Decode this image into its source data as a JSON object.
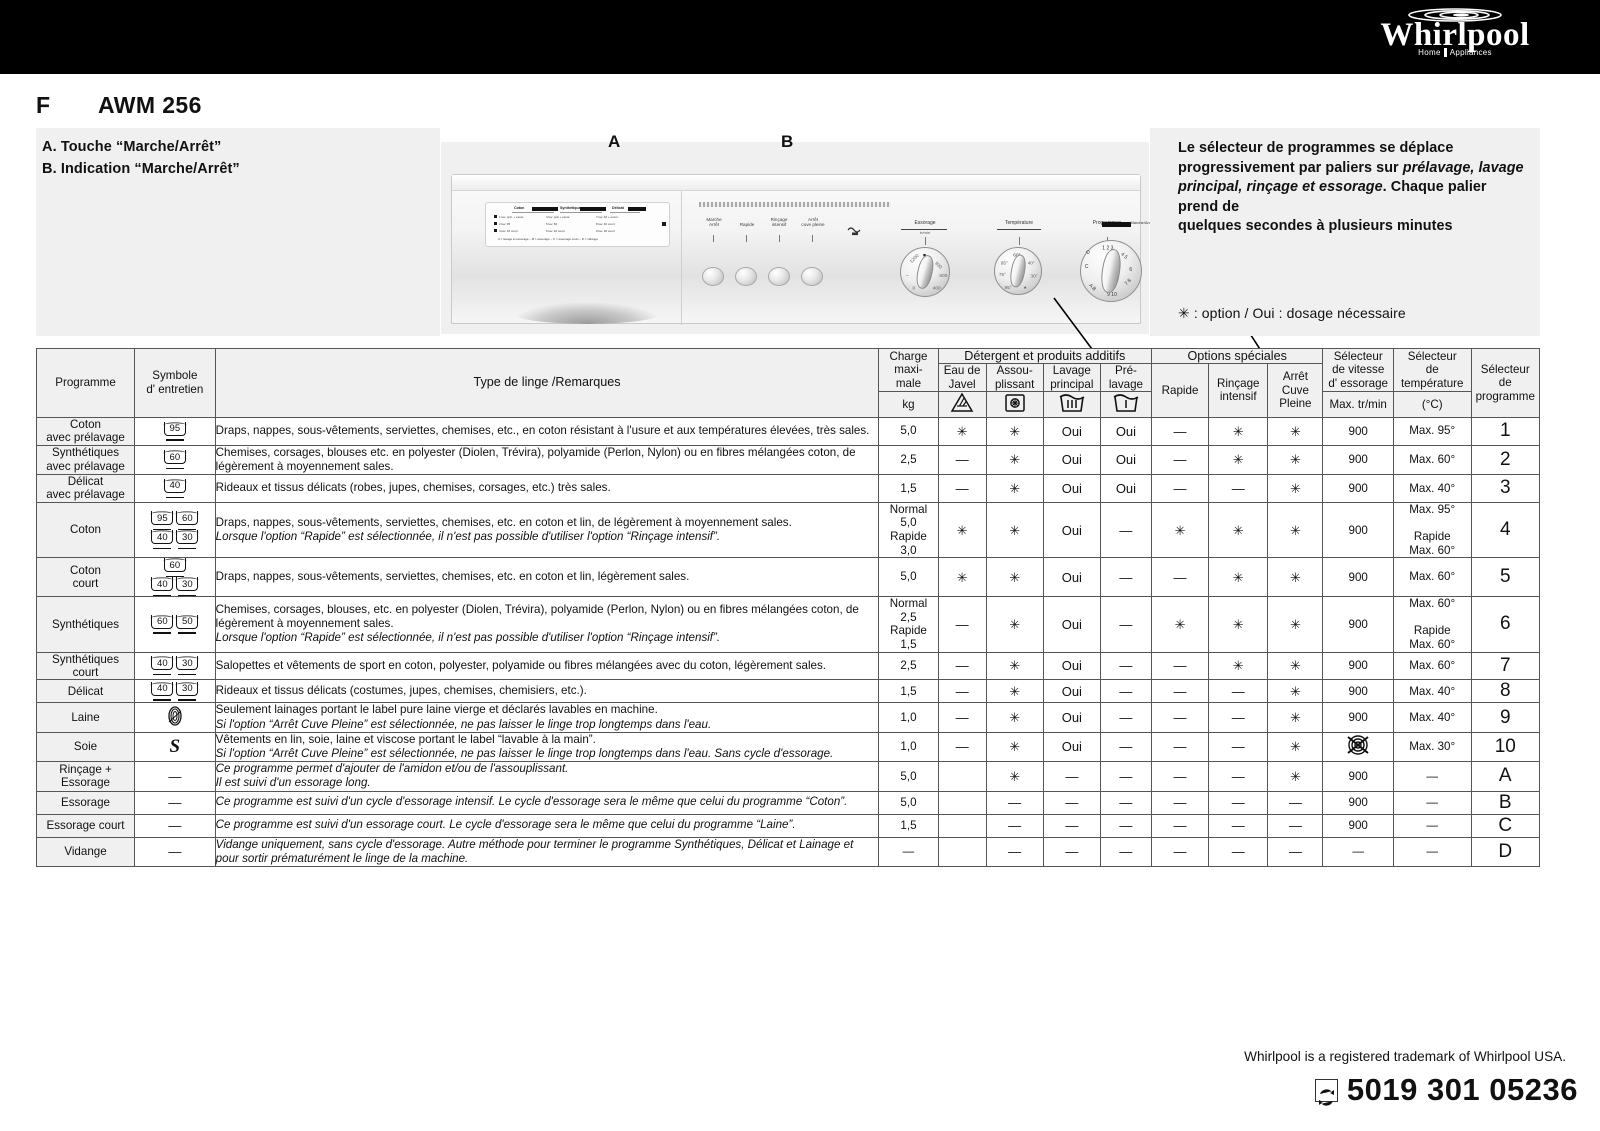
{
  "brand": {
    "name": "Whirlpool",
    "tagline_left": "Home",
    "tagline_right": "Appliances"
  },
  "header": {
    "language_code": "F",
    "model": "AWM 256"
  },
  "legend_box": {
    "items": [
      "A. Touche “Marche/Arrêt”",
      "B. Indication “Marche/Arrêt”"
    ]
  },
  "callouts": {
    "a": "A",
    "b": "B"
  },
  "illustration": {
    "program_card": {
      "columns": [
        "Coton",
        "Synthétiques",
        "Délicat"
      ],
      "footer": "A = lavage et essorage  –  B = essorage  –  C = essorage court  –  D = vidange"
    },
    "buttons": [
      {
        "label_line1": "Marche",
        "label_line2": "Arrêt"
      },
      {
        "label_line1": "Rapide",
        "label_line2": ""
      },
      {
        "label_line1": "Rinçage",
        "label_line2": "intensif"
      },
      {
        "label_line1": "Arrêt",
        "label_line2": "cuve pleine"
      }
    ],
    "knobs": [
      {
        "label": "Essorage",
        "sub": "tr/min"
      },
      {
        "label": "Température",
        "sub": ""
      },
      {
        "label": "Programmes",
        "sub": ""
      }
    ],
    "selector_side_label": "Marche/Arrêt"
  },
  "note": {
    "line1": "Le sélecteur de programmes se déplace",
    "line2_plain": "progressivement par paliers sur ",
    "line2_em": "prélavage, lavage",
    "line3_em": "principal, rinçage et essorage",
    "line3_plain": ". Chaque palier prend de",
    "line4": "quelques secondes à plusieurs minutes",
    "legend": "✳ : option / Oui : dosage nécessaire"
  },
  "table": {
    "headers": {
      "programme": "Programme",
      "symbole": "Symbole\nd' entretien",
      "type_linge": "Type de linge /Remarques",
      "charge": "Charge\nmaxi-\nmale",
      "charge_unit": "kg",
      "group_detergent": "Détergent et produits additifs",
      "group_options": "Options spéciales",
      "eau_javel": "Eau de\nJavel",
      "assouplissant": "Assou-\nplissant",
      "lavage_principal": "Lavage\nprincipal",
      "prelavage": "Pré-\nlavage",
      "rapide": "Rapide",
      "rincage_intensif": "Rinçage\nintensif",
      "arret_cuve": "Arrêt\nCuve\nPleine",
      "sel_vitesse": "Sélecteur\nde vitesse\nd' essorage",
      "sel_vitesse_unit": "Max. tr/min",
      "sel_temp": "Sélecteur\nde\ntempérature",
      "sel_temp_unit": "(°C)",
      "sel_prog": "Sélecteur\nde\nprogramme"
    },
    "rows": [
      {
        "programme": "Coton\navec prélavage",
        "symbols": [
          [
            "95"
          ]
        ],
        "desc": "Draps, nappes, sous-vêtements, serviettes, chemises, etc., en coton résistant à l'usure et aux températures élevées, très sales.",
        "desc_italic": "",
        "charge": "5,0",
        "eau_javel": "✳",
        "assouplissant": "✳",
        "lavage_principal": "Oui",
        "prelavage": "Oui",
        "rapide": "—",
        "rincage_intensif": "✳",
        "arret_cuve": "✳",
        "vitesse": "900",
        "temperature": "Max. 95°",
        "prog": "1"
      },
      {
        "programme": "Synthétiques\navec prélavage",
        "symbols": [
          [
            "60"
          ]
        ],
        "desc": "Chemises, corsages, blouses etc. en polyester (Diolen, Trévira), polyamide (Perlon, Nylon) ou en fibres mélangées coton, de légèrement à moyennement sales.",
        "desc_italic": "",
        "charge": "2,5",
        "eau_javel": "—",
        "assouplissant": "✳",
        "lavage_principal": "Oui",
        "prelavage": "Oui",
        "rapide": "—",
        "rincage_intensif": "✳",
        "arret_cuve": "✳",
        "vitesse": "900",
        "temperature": "Max. 60°",
        "prog": "2"
      },
      {
        "programme": "Délicat\navec prélavage",
        "symbols": [
          [
            "40"
          ]
        ],
        "desc": "Rideaux et tissus délicats (robes, jupes, chemises, corsages, etc.) très sales.",
        "desc_italic": "",
        "charge": "1,5",
        "eau_javel": "—",
        "assouplissant": "✳",
        "lavage_principal": "Oui",
        "prelavage": "Oui",
        "rapide": "—",
        "rincage_intensif": "—",
        "arret_cuve": "✳",
        "vitesse": "900",
        "temperature": "Max. 40°",
        "prog": "3"
      },
      {
        "programme": "Coton",
        "symbols": [
          [
            "95",
            "60"
          ],
          [
            "40",
            "30"
          ]
        ],
        "desc": "Draps, nappes, sous-vêtements, serviettes, chemises, etc. en coton et lin, de légèrement à moyennement sales.",
        "desc_italic": "Lorsque l'option “Rapide” est sélectionnée, il n'est pas possible d'utiliser l'option “Rinçage intensif”.",
        "charge": "Normal\n5,0\nRapide\n3,0",
        "eau_javel": "✳",
        "assouplissant": "✳",
        "lavage_principal": "Oui",
        "prelavage": "—",
        "rapide": "✳",
        "rincage_intensif": "✳",
        "arret_cuve": "✳",
        "vitesse": "900",
        "temperature": "Max. 95°\n\nRapide\nMax. 60°",
        "prog": "4"
      },
      {
        "programme": "Coton\ncourt",
        "symbols": [
          [
            "60"
          ],
          [
            "40",
            "30"
          ]
        ],
        "desc": "Draps, nappes, sous-vêtements, serviettes, chemises, etc. en coton et lin, légèrement sales.",
        "desc_italic": "",
        "charge": "5,0",
        "eau_javel": "✳",
        "assouplissant": "✳",
        "lavage_principal": "Oui",
        "prelavage": "—",
        "rapide": "—",
        "rincage_intensif": "✳",
        "arret_cuve": "✳",
        "vitesse": "900",
        "temperature": "Max. 60°",
        "prog": "5"
      },
      {
        "programme": "Synthétiques",
        "symbols": [
          [
            "60",
            "50"
          ]
        ],
        "desc": "Chemises, corsages, blouses, etc. en polyester (Diolen, Trévira), polyamide (Perlon, Nylon) ou en fibres mélangées coton, de légèrement à moyennement sales.",
        "desc_italic": "Lorsque l'option “Rapide” est sélectionnée, il n'est pas possible d'utiliser l'option “Rinçage intensif”.",
        "charge": "Normal\n2,5\nRapide\n1,5",
        "eau_javel": "—",
        "assouplissant": "✳",
        "lavage_principal": "Oui",
        "prelavage": "—",
        "rapide": "✳",
        "rincage_intensif": "✳",
        "arret_cuve": "✳",
        "vitesse": "900",
        "temperature": "Max. 60°\n\nRapide\nMax. 60°",
        "prog": "6"
      },
      {
        "programme": "Synthétiques\ncourt",
        "symbols": [
          [
            "40",
            "30"
          ]
        ],
        "desc": "Salopettes et vêtements de sport en coton, polyester, polyamide ou fibres mélangées avec du coton, légèrement sales.",
        "desc_italic": "",
        "charge": "2,5",
        "eau_javel": "—",
        "assouplissant": "✳",
        "lavage_principal": "Oui",
        "prelavage": "—",
        "rapide": "—",
        "rincage_intensif": "✳",
        "arret_cuve": "✳",
        "vitesse": "900",
        "temperature": "Max. 60°",
        "prog": "7"
      },
      {
        "programme": "Délicat",
        "symbols": [
          [
            "40",
            "30"
          ]
        ],
        "desc": "Rideaux et tissus délicats (costumes, jupes, chemises, chemisiers, etc.).",
        "desc_italic": "",
        "charge": "1,5",
        "eau_javel": "—",
        "assouplissant": "✳",
        "lavage_principal": "Oui",
        "prelavage": "—",
        "rapide": "—",
        "rincage_intensif": "—",
        "arret_cuve": "✳",
        "vitesse": "900",
        "temperature": "Max. 40°",
        "prog": "8"
      },
      {
        "programme": "Laine",
        "symbols": [],
        "symbol_kind": "wool",
        "desc": "Seulement lainages portant le label pure laine vierge et déclarés lavables en machine.",
        "desc_italic": "Si l'option “Arrêt Cuve Pleine” est sélectionnée, ne pas laisser le linge trop longtemps dans l'eau.",
        "charge": "1,0",
        "eau_javel": "—",
        "assouplissant": "✳",
        "lavage_principal": "Oui",
        "prelavage": "—",
        "rapide": "—",
        "rincage_intensif": "—",
        "arret_cuve": "✳",
        "vitesse": "900",
        "temperature": "Max. 40°",
        "prog": "9"
      },
      {
        "programme": "Soie",
        "symbols": [],
        "symbol_kind": "silk",
        "desc": "Vêtements en lin, soie, laine et viscose portant le label “lavable à la main”.",
        "desc_italic": "Si l'option “Arrêt Cuve Pleine” est sélectionnée, ne pas laisser le linge trop longtemps dans l'eau. Sans cycle d'essorage.",
        "charge": "1,0",
        "eau_javel": "—",
        "assouplissant": "✳",
        "lavage_principal": "Oui",
        "prelavage": "—",
        "rapide": "—",
        "rincage_intensif": "—",
        "arret_cuve": "✳",
        "vitesse": "no-spin-icon",
        "temperature": "Max. 30°",
        "prog": "10"
      },
      {
        "programme": "Rinçage +\nEssorage",
        "symbols": [],
        "symbol_kind": "dash",
        "desc": "",
        "desc_italic": "Ce programme permet d'ajouter de l'amidon et/ou de l'assouplissant.\nIl est suivi d'un essorage long.",
        "charge": "5,0",
        "eau_javel": "",
        "assouplissant": "✳",
        "lavage_principal": "—",
        "prelavage": "—",
        "rapide": "—",
        "rincage_intensif": "—",
        "arret_cuve": "✳",
        "vitesse": "900",
        "temperature": "—",
        "prog": "A"
      },
      {
        "programme": "Essorage",
        "symbols": [],
        "symbol_kind": "dash",
        "desc": "",
        "desc_italic": "Ce programme est suivi d'un cycle d'essorage intensif. Le cycle d'essorage sera le même que celui du programme “Coton”.",
        "charge": "5,0",
        "eau_javel": "",
        "assouplissant": "—",
        "lavage_principal": "—",
        "prelavage": "—",
        "rapide": "—",
        "rincage_intensif": "—",
        "arret_cuve": "—",
        "vitesse": "900",
        "temperature": "—",
        "prog": "B"
      },
      {
        "programme": "Essorage court",
        "symbols": [],
        "symbol_kind": "dash",
        "desc": "",
        "desc_italic": "Ce programme est suivi d'un essorage court. Le cycle d'essorage sera le même que celui du programme “Laine”.",
        "charge": "1,5",
        "eau_javel": "",
        "assouplissant": "—",
        "lavage_principal": "—",
        "prelavage": "—",
        "rapide": "—",
        "rincage_intensif": "—",
        "arret_cuve": "—",
        "vitesse": "900",
        "temperature": "—",
        "prog": "C"
      },
      {
        "programme": "Vidange",
        "symbols": [],
        "symbol_kind": "dash",
        "desc": "",
        "desc_italic": "Vidange uniquement, sans cycle d'essorage. Autre méthode pour terminer le programme Synthétiques, Délicat et Lainage et pour sortir prématurément le linge de la machine.",
        "charge": "—",
        "eau_javel": "",
        "assouplissant": "—",
        "lavage_principal": "—",
        "prelavage": "—",
        "rapide": "—",
        "rincage_intensif": "—",
        "arret_cuve": "—",
        "vitesse": "—",
        "temperature": "—",
        "prog": "D"
      }
    ]
  },
  "footer": {
    "trademark": "Whirlpool is a registered trademark of Whirlpool USA.",
    "code": "5019 301 05236"
  }
}
